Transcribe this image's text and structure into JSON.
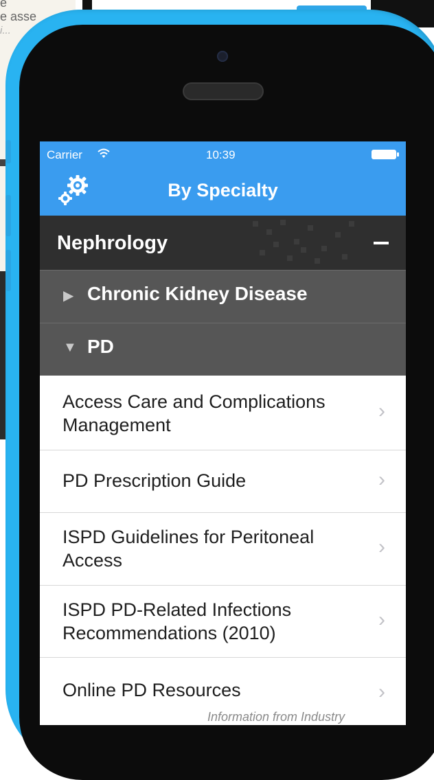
{
  "background_text": {
    "line1": "e",
    "line2": "e asse",
    "line3": "i..."
  },
  "status_bar": {
    "carrier": "Carrier",
    "wifi_icon": "wifi-icon",
    "time": "10:39",
    "battery_icon": "battery-icon"
  },
  "nav": {
    "title": "By Specialty",
    "settings_icon": "gear-icon"
  },
  "specialty": {
    "title": "Nephrology",
    "toggle_icon": "minus-icon"
  },
  "categories": [
    {
      "label": "Chronic Kidney Disease",
      "arrow": "▶",
      "state": "collapsed"
    },
    {
      "label": "PD",
      "arrow": "▼",
      "state": "expanded"
    }
  ],
  "items": [
    {
      "label": "Access Care and Complications Management"
    },
    {
      "label": "PD Prescription Guide"
    },
    {
      "label": "ISPD Guidelines for Peritoneal Access"
    },
    {
      "label": "ISPD PD-Related Infections Recommendations (2010)"
    },
    {
      "label": "Online PD Resources"
    }
  ],
  "chevron": "›",
  "footnote": "Information from Industry",
  "colors": {
    "phone_shell": "#29b3f1",
    "nav_bar": "#3a9cef",
    "specialty_header": "#2f2f2f",
    "category_row": "#565656"
  }
}
